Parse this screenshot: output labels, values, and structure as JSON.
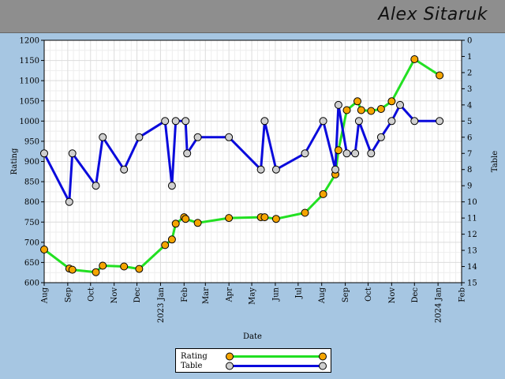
{
  "header": {
    "player_name": "Alex Sitaruk"
  },
  "colors": {
    "rating": "#22e022",
    "table": "#0a0adc",
    "rating_marker": "#f5a500",
    "table_marker": "#cfcfcf",
    "background": "#a6c6e2",
    "plot_bg": "#ffffff",
    "grid": "#dcdcdc"
  },
  "legend": [
    {
      "label": "Rating",
      "series": "rating"
    },
    {
      "label": "Table",
      "series": "table"
    }
  ],
  "chart_data": {
    "type": "line",
    "xlabel": "Date",
    "ylabel": "Rating",
    "y2label": "Table",
    "xlim": [
      "2022-08-01",
      "2024-02-01"
    ],
    "ylim": [
      600,
      1200
    ],
    "y2lim": [
      0,
      15
    ],
    "y2_inverted": true,
    "grid": true,
    "legend_position": "bottom-center",
    "x_ticks": [
      {
        "date": "2022-08-01",
        "label": "Aug"
      },
      {
        "date": "2022-09-01",
        "label": "Sep"
      },
      {
        "date": "2022-10-01",
        "label": "Oct"
      },
      {
        "date": "2022-11-01",
        "label": "Nov"
      },
      {
        "date": "2022-12-01",
        "label": "Dec"
      },
      {
        "date": "2023-01-01",
        "label": "2023 Jan"
      },
      {
        "date": "2023-02-01",
        "label": "Feb"
      },
      {
        "date": "2023-03-01",
        "label": "Mar"
      },
      {
        "date": "2023-04-01",
        "label": "Apr"
      },
      {
        "date": "2023-05-01",
        "label": "May"
      },
      {
        "date": "2023-06-01",
        "label": "Jun"
      },
      {
        "date": "2023-07-01",
        "label": "Jul"
      },
      {
        "date": "2023-08-01",
        "label": "Aug"
      },
      {
        "date": "2023-09-01",
        "label": "Sep"
      },
      {
        "date": "2023-10-01",
        "label": "Oct"
      },
      {
        "date": "2023-11-01",
        "label": "Nov"
      },
      {
        "date": "2023-12-01",
        "label": "Dec"
      },
      {
        "date": "2024-01-01",
        "label": "2024 Jan"
      },
      {
        "date": "2024-02-01",
        "label": "Feb"
      }
    ],
    "y_ticks": [
      600,
      650,
      700,
      750,
      800,
      850,
      900,
      950,
      1000,
      1050,
      1100,
      1150,
      1200
    ],
    "y2_ticks": [
      0,
      1,
      2,
      3,
      4,
      5,
      6,
      7,
      8,
      9,
      10,
      11,
      12,
      13,
      14,
      15
    ],
    "series": [
      {
        "name": "Rating",
        "axis": "left",
        "points": [
          {
            "date": "2022-08-01",
            "value": 682
          },
          {
            "date": "2022-09-03",
            "value": 635
          },
          {
            "date": "2022-09-07",
            "value": 632
          },
          {
            "date": "2022-10-08",
            "value": 626
          },
          {
            "date": "2022-10-17",
            "value": 642
          },
          {
            "date": "2022-11-14",
            "value": 640
          },
          {
            "date": "2022-12-04",
            "value": 634
          },
          {
            "date": "2023-01-07",
            "value": 693
          },
          {
            "date": "2023-01-16",
            "value": 707
          },
          {
            "date": "2023-01-21",
            "value": 746
          },
          {
            "date": "2023-02-01",
            "value": 762
          },
          {
            "date": "2023-02-03",
            "value": 758
          },
          {
            "date": "2023-02-19",
            "value": 748
          },
          {
            "date": "2023-04-01",
            "value": 760
          },
          {
            "date": "2023-05-13",
            "value": 762
          },
          {
            "date": "2023-05-18",
            "value": 762
          },
          {
            "date": "2023-06-02",
            "value": 758
          },
          {
            "date": "2023-07-10",
            "value": 773
          },
          {
            "date": "2023-08-03",
            "value": 819
          },
          {
            "date": "2023-08-19",
            "value": 868
          },
          {
            "date": "2023-08-23",
            "value": 928
          },
          {
            "date": "2023-09-03",
            "value": 1027
          },
          {
            "date": "2023-09-17",
            "value": 1049
          },
          {
            "date": "2023-09-22",
            "value": 1027
          },
          {
            "date": "2023-10-05",
            "value": 1025
          },
          {
            "date": "2023-10-18",
            "value": 1030
          },
          {
            "date": "2023-11-01",
            "value": 1049
          },
          {
            "date": "2023-12-01",
            "value": 1153
          },
          {
            "date": "2024-01-03",
            "value": 1113
          }
        ]
      },
      {
        "name": "Table",
        "axis": "right",
        "points": [
          {
            "date": "2022-08-01",
            "value": 7
          },
          {
            "date": "2022-09-03",
            "value": 10
          },
          {
            "date": "2022-09-07",
            "value": 7
          },
          {
            "date": "2022-10-08",
            "value": 9
          },
          {
            "date": "2022-10-17",
            "value": 6
          },
          {
            "date": "2022-11-14",
            "value": 8
          },
          {
            "date": "2022-12-04",
            "value": 6
          },
          {
            "date": "2023-01-07",
            "value": 5
          },
          {
            "date": "2023-01-16",
            "value": 9
          },
          {
            "date": "2023-01-21",
            "value": 5
          },
          {
            "date": "2023-02-03",
            "value": 5
          },
          {
            "date": "2023-02-05",
            "value": 7
          },
          {
            "date": "2023-02-19",
            "value": 6
          },
          {
            "date": "2023-04-01",
            "value": 6
          },
          {
            "date": "2023-05-13",
            "value": 8
          },
          {
            "date": "2023-05-18",
            "value": 5
          },
          {
            "date": "2023-06-02",
            "value": 8
          },
          {
            "date": "2023-07-10",
            "value": 7
          },
          {
            "date": "2023-08-03",
            "value": 5
          },
          {
            "date": "2023-08-19",
            "value": 8
          },
          {
            "date": "2023-08-23",
            "value": 4
          },
          {
            "date": "2023-09-03",
            "value": 7
          },
          {
            "date": "2023-09-14",
            "value": 7
          },
          {
            "date": "2023-09-19",
            "value": 5
          },
          {
            "date": "2023-10-05",
            "value": 7
          },
          {
            "date": "2023-10-18",
            "value": 6
          },
          {
            "date": "2023-11-01",
            "value": 5
          },
          {
            "date": "2023-11-12",
            "value": 4
          },
          {
            "date": "2023-12-01",
            "value": 5
          },
          {
            "date": "2024-01-03",
            "value": 5
          }
        ]
      }
    ]
  }
}
